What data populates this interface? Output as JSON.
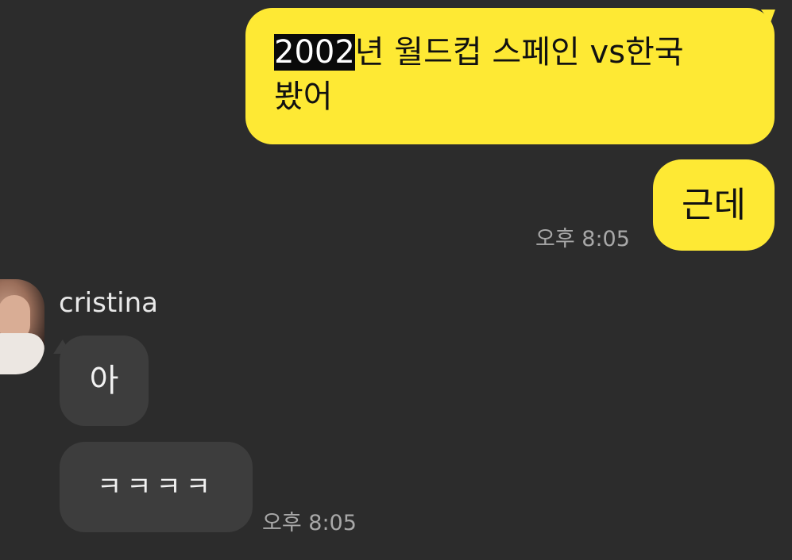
{
  "messages": [
    {
      "direction": "outgoing",
      "highlight": "2002",
      "text_rest": "년 월드컵 스페인 vs한국",
      "line2": "봤어"
    },
    {
      "direction": "outgoing",
      "text": "근데",
      "time": "오후 8:05"
    },
    {
      "direction": "incoming",
      "sender": "cristina",
      "avatar_icon": "user-avatar-photo",
      "text": "아"
    },
    {
      "direction": "incoming",
      "text": "ㅋㅋㅋㅋ",
      "time": "오후 8:05"
    }
  ],
  "colors": {
    "background": "#2c2c2c",
    "outgoing_bubble": "#fee934",
    "incoming_bubble": "#3d3d3d",
    "timestamp": "#a8a8a8"
  }
}
